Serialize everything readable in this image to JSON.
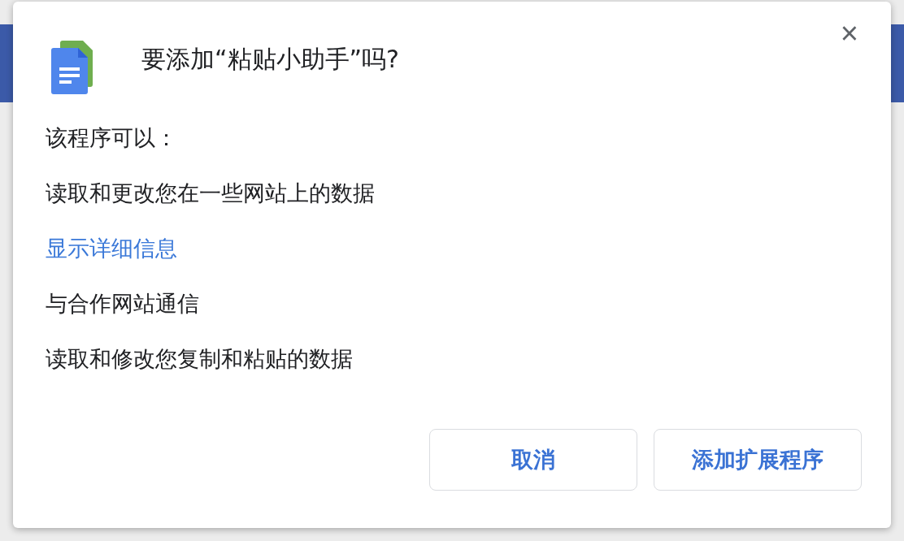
{
  "dialog": {
    "title": "要添加“粘贴小助手”吗?",
    "close": "×",
    "intro": "该程序可以：",
    "items": [
      {
        "kind": "text",
        "text": "读取和更改您在一些网站上的数据"
      },
      {
        "kind": "link",
        "text": "显示详细信息"
      },
      {
        "kind": "text",
        "text": "与合作网站通信"
      },
      {
        "kind": "text",
        "text": "读取和修改您复制和粘贴的数据"
      }
    ],
    "buttons": [
      "取消",
      "添加扩展程序"
    ]
  }
}
